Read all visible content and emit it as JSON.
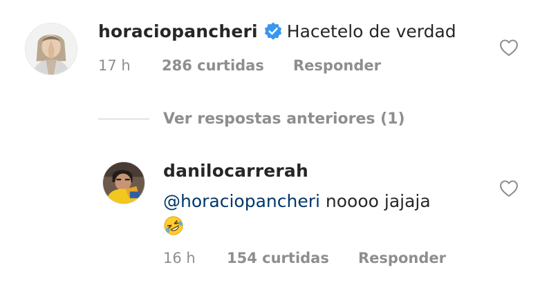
{
  "comments": [
    {
      "username": "horaciopancheri",
      "verified": true,
      "text": "Hacetelo de verdad",
      "time": "17 h",
      "likes": "286 curtidas",
      "reply_label": "Responder"
    },
    {
      "username": "danilocarrerah",
      "verified": false,
      "mention": "@horaciopancheri",
      "text": " noooo jajaja",
      "emoji": "rolling-on-floor-laughing",
      "time": "16 h",
      "likes": "154 curtidas",
      "reply_label": "Responder"
    }
  ],
  "view_previous_replies": "Ver respostas anteriores (1)",
  "colors": {
    "verified_blue": "#3897f0",
    "mention_blue": "#00376b",
    "secondary_gray": "#8e8e8e"
  }
}
